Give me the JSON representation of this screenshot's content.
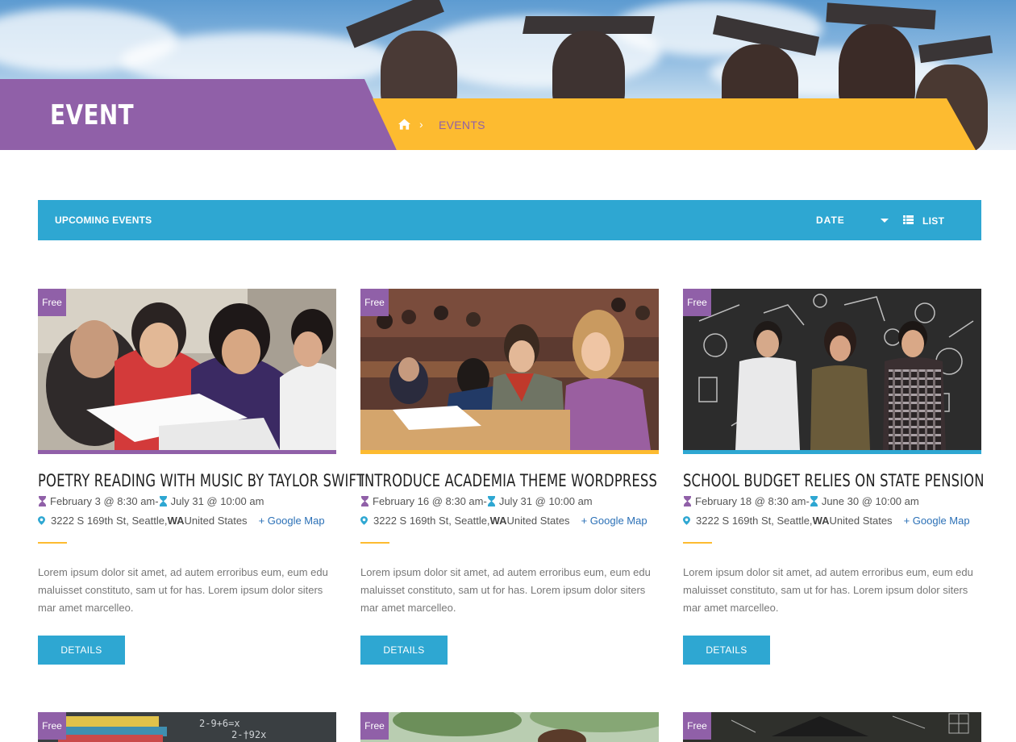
{
  "header": {
    "title": "EVENT"
  },
  "breadcrumb": {
    "current": "EVENTS",
    "separator": "›"
  },
  "filter_bar": {
    "label": "UPCOMING EVENTS",
    "sort_selected": "DATE",
    "view_label": "LIST"
  },
  "events": [
    {
      "badge": "Free",
      "title": "POETRY READING WITH MUSIC BY TAYLOR SWIFT",
      "start": "February 3 @ 8:30 am",
      "date_sep": " - ",
      "end": "July 31 @ 10:00 am",
      "address": "3222 S 169th St, Seattle, ",
      "state": "WA",
      "country": " United States",
      "map_link": "+ Google Map",
      "excerpt": "Lorem ipsum dolor sit amet, ad autem erroribus eum, eum edu maluisset constituto, sam ut for has. Lorem ipsum dolor siters mar amet marcelleo.",
      "button": "DETAILS",
      "stripe_color": "#9060a8"
    },
    {
      "badge": "Free",
      "title": "INTRODUCE ACADEMIA THEME WORDPRESS",
      "start": "February 16 @ 8:30 am",
      "date_sep": " - ",
      "end": "July 31 @ 10:00 am",
      "address": "3222 S 169th St, Seattle, ",
      "state": "WA",
      "country": " United States",
      "map_link": "+ Google Map",
      "excerpt": "Lorem ipsum dolor sit amet, ad autem erroribus eum, eum edu maluisset constituto, sam ut for has. Lorem ipsum dolor siters mar amet marcelleo.",
      "button": "DETAILS",
      "stripe_color": "#fdbb30"
    },
    {
      "badge": "Free",
      "title": "SCHOOL BUDGET RELIES ON STATE PENSION",
      "start": "February 18 @ 8:30 am",
      "date_sep": " - ",
      "end": "June 30 @ 10:00 am",
      "address": "3222 S 169th St, Seattle, ",
      "state": "WA",
      "country": " United States",
      "map_link": "+ Google Map",
      "excerpt": "Lorem ipsum dolor sit amet, ad autem erroribus eum, eum edu maluisset constituto, sam ut for has. Lorem ipsum dolor siters mar amet marcelleo.",
      "button": "DETAILS",
      "stripe_color": "#2ea7d2"
    }
  ],
  "next_row": [
    {
      "badge": "Free"
    },
    {
      "badge": "Free"
    },
    {
      "badge": "Free"
    }
  ],
  "colors": {
    "purple": "#9060a8",
    "yellow": "#fdbb30",
    "blue": "#2ea7d2",
    "link": "#2b70b6"
  },
  "icons": {
    "home": "home-icon",
    "list": "list-icon",
    "caret": "chevron-down-icon",
    "hourglass": "hourglass-icon",
    "pin": "map-pin-icon"
  }
}
